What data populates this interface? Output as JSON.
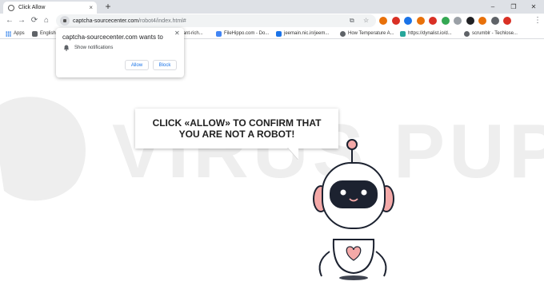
{
  "tab": {
    "title": "Click Allow",
    "close_icon": "×",
    "new_tab_icon": "+"
  },
  "window_controls": {
    "minimize": "–",
    "maximize": "❐",
    "close": "✕"
  },
  "toolbar": {
    "back_icon": "←",
    "forward_icon": "→",
    "reload_icon": "⟳",
    "home_icon": "⌂",
    "url_host": "captcha-sourcecenter.com",
    "url_path": "/robot4/index.html#",
    "translate_icon": "⧉",
    "star_icon": "☆",
    "menu_icon": "⋮",
    "extension_colors": [
      "#e8710a",
      "#d93025",
      "#1a73e8",
      "#e8710a",
      "#d93025",
      "#34a853",
      "#9aa0a6",
      "#202124",
      "#e8710a",
      "#5f6368",
      "#d93025"
    ]
  },
  "bookmarks": [
    {
      "label": "Apps",
      "icon": "apps-grid",
      "color": "#1a73e8"
    },
    {
      "label": "English",
      "icon": "bookmark-icon",
      "color": "#5f6368"
    },
    {
      "label": "rodant-rich...",
      "icon": "bookmark-icon",
      "color": "#9aa0a6"
    },
    {
      "label": "FileHippo.com - Do...",
      "icon": "filehippo-icon",
      "color": "#4285f4"
    },
    {
      "label": "jeemain.nic.in/jeem...",
      "icon": "jee-icon",
      "color": "#1a73e8"
    },
    {
      "label": "How Temperature A...",
      "icon": "globe-icon",
      "color": "#5f6368"
    },
    {
      "label": "https://dynalist.io/d...",
      "icon": "dynalist-icon",
      "color": "#26a69a"
    },
    {
      "label": "scrumblr - Techlose...",
      "icon": "globe-icon",
      "color": "#5f6368"
    }
  ],
  "permission": {
    "title": "captcha-sourcecenter.com wants to",
    "label": "Show notifications",
    "allow": "Allow",
    "block": "Block",
    "close_icon": "✕"
  },
  "page": {
    "message": "CLICK «ALLOW» TO CONFIRM THAT YOU ARE NOT A ROBOT!",
    "watermark": "VIRUS PUP",
    "robot_heart_color": "#f4a9a8",
    "robot_visor_color": "#1c2230"
  }
}
